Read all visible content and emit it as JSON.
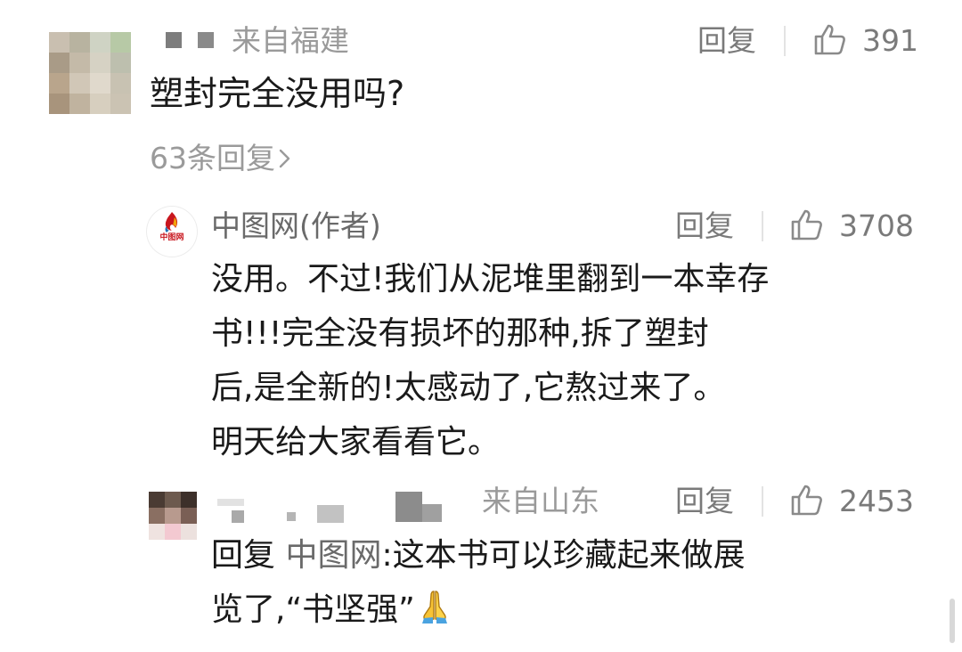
{
  "comment1": {
    "location": "来自福建",
    "reply_label": "回复",
    "like_count": "391",
    "text": "塑封完全没用吗?",
    "replies_link": "63条回复"
  },
  "reply1": {
    "author": "中图网(作者)",
    "logo_text": "中图网",
    "reply_label": "回复",
    "like_count": "3708",
    "lines": [
      "没用。不过!我们从泥堆里翻到一本幸存",
      "书!!!完全没有损坏的那种,拆了塑封",
      "后,是全新的!太感动了,它熬过来了。",
      "明天给大家看看它。"
    ]
  },
  "reply2": {
    "location": "来自山东",
    "reply_label": "回复",
    "like_count": "2453",
    "reply_prefix": "回复",
    "reply_target": "中图网",
    "line1_rest": ":这本书可以珍藏起来做展",
    "line2": "览了,“书坚强”",
    "emoji": "folded-hands"
  },
  "colors": {
    "text": "#1a1a1a",
    "meta": "#9a9a9a",
    "name": "#6a6a6a",
    "logo_red": "#c8161e"
  }
}
